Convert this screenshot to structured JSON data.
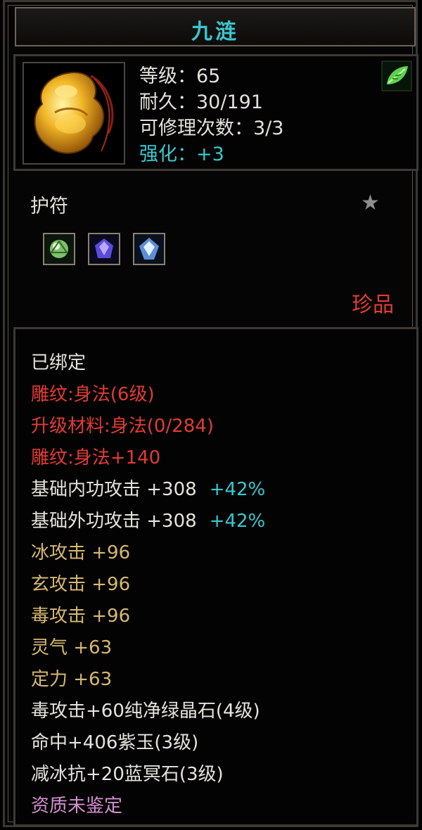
{
  "title": "九涟",
  "item": {
    "icon": "yellow-jade-amulet-icon",
    "badge": "green-leaf-icon",
    "level": "等级：65",
    "durability": "耐久：30/191",
    "repair_count": "可修理次数：3/3",
    "enhance": "强化：+3"
  },
  "type_label": "护符",
  "gems": [
    "green-gem-icon",
    "purple-gem-icon",
    "blue-gem-icon"
  ],
  "rarity": "珍品",
  "attributes": [
    {
      "text": "已绑定",
      "color": "#e6e3dd"
    },
    {
      "text": "雕纹:身法(6级)",
      "color": "#e23b34"
    },
    {
      "text": "升级材料:身法(0/284)",
      "color": "#e23b34"
    },
    {
      "text": "雕纹:身法+140",
      "color": "#e23b34"
    },
    {
      "text": "基础内功攻击  +308",
      "bonus": "+42%",
      "color": "#e6e3dd"
    },
    {
      "text": "基础外功攻击  +308",
      "bonus": "+42%",
      "color": "#e6e3dd"
    },
    {
      "text": "冰攻击  +96",
      "color": "#d8b870"
    },
    {
      "text": "玄攻击  +96",
      "color": "#d8b870"
    },
    {
      "text": "毒攻击  +96",
      "color": "#d8b870"
    },
    {
      "text": "灵气  +63",
      "color": "#d8b870"
    },
    {
      "text": "定力  +63",
      "color": "#d8b870"
    },
    {
      "text": "毒攻击+60纯净绿晶石(4级)",
      "color": "#e6e3dd"
    },
    {
      "text": "命中+406紫玉(3级)",
      "color": "#e6e3dd"
    },
    {
      "text": "减冰抗+20蓝冥石(3级)",
      "color": "#e6e3dd"
    },
    {
      "text": "资质未鉴定",
      "color": "#d38fd0"
    }
  ]
}
